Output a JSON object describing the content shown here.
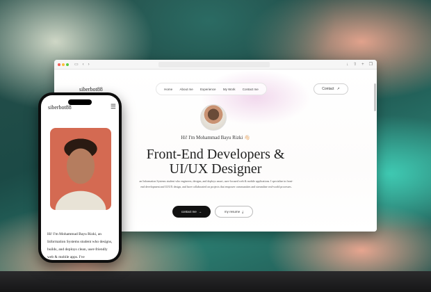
{
  "desktop": {
    "logo": "siberbot88",
    "nav": [
      "Home",
      "About me",
      "Experience",
      "My Work",
      "Contact me"
    ],
    "contact_button": "Contact",
    "greeting": "Hi! I'm Mohammad Bayu Rizki 👋🏻",
    "headline_line1": "Front-End Developers &",
    "headline_line2": "UI/UX Designer",
    "intro": "an Information Systems student who engineers, designs, and deploys smart, user-focused web & mobile applications. I specialize in front-end development and UI/UX design, and have collaborated on projects that empower communities and streamline real-world processes.",
    "primary_button": "contact me",
    "secondary_button": "my resume"
  },
  "mobile": {
    "logo": "siberbot88",
    "intro": "Hi! I'm Mohammad Bayu Rizki, an Information Systems student who designs, builds, and deploys clean, user-friendly web & mobile apps. I've"
  },
  "icons": {
    "contact": "arrow-up-right-icon",
    "contact_me": "arrow-right-icon",
    "resume": "download-icon",
    "menu": "hamburger-menu-icon"
  }
}
